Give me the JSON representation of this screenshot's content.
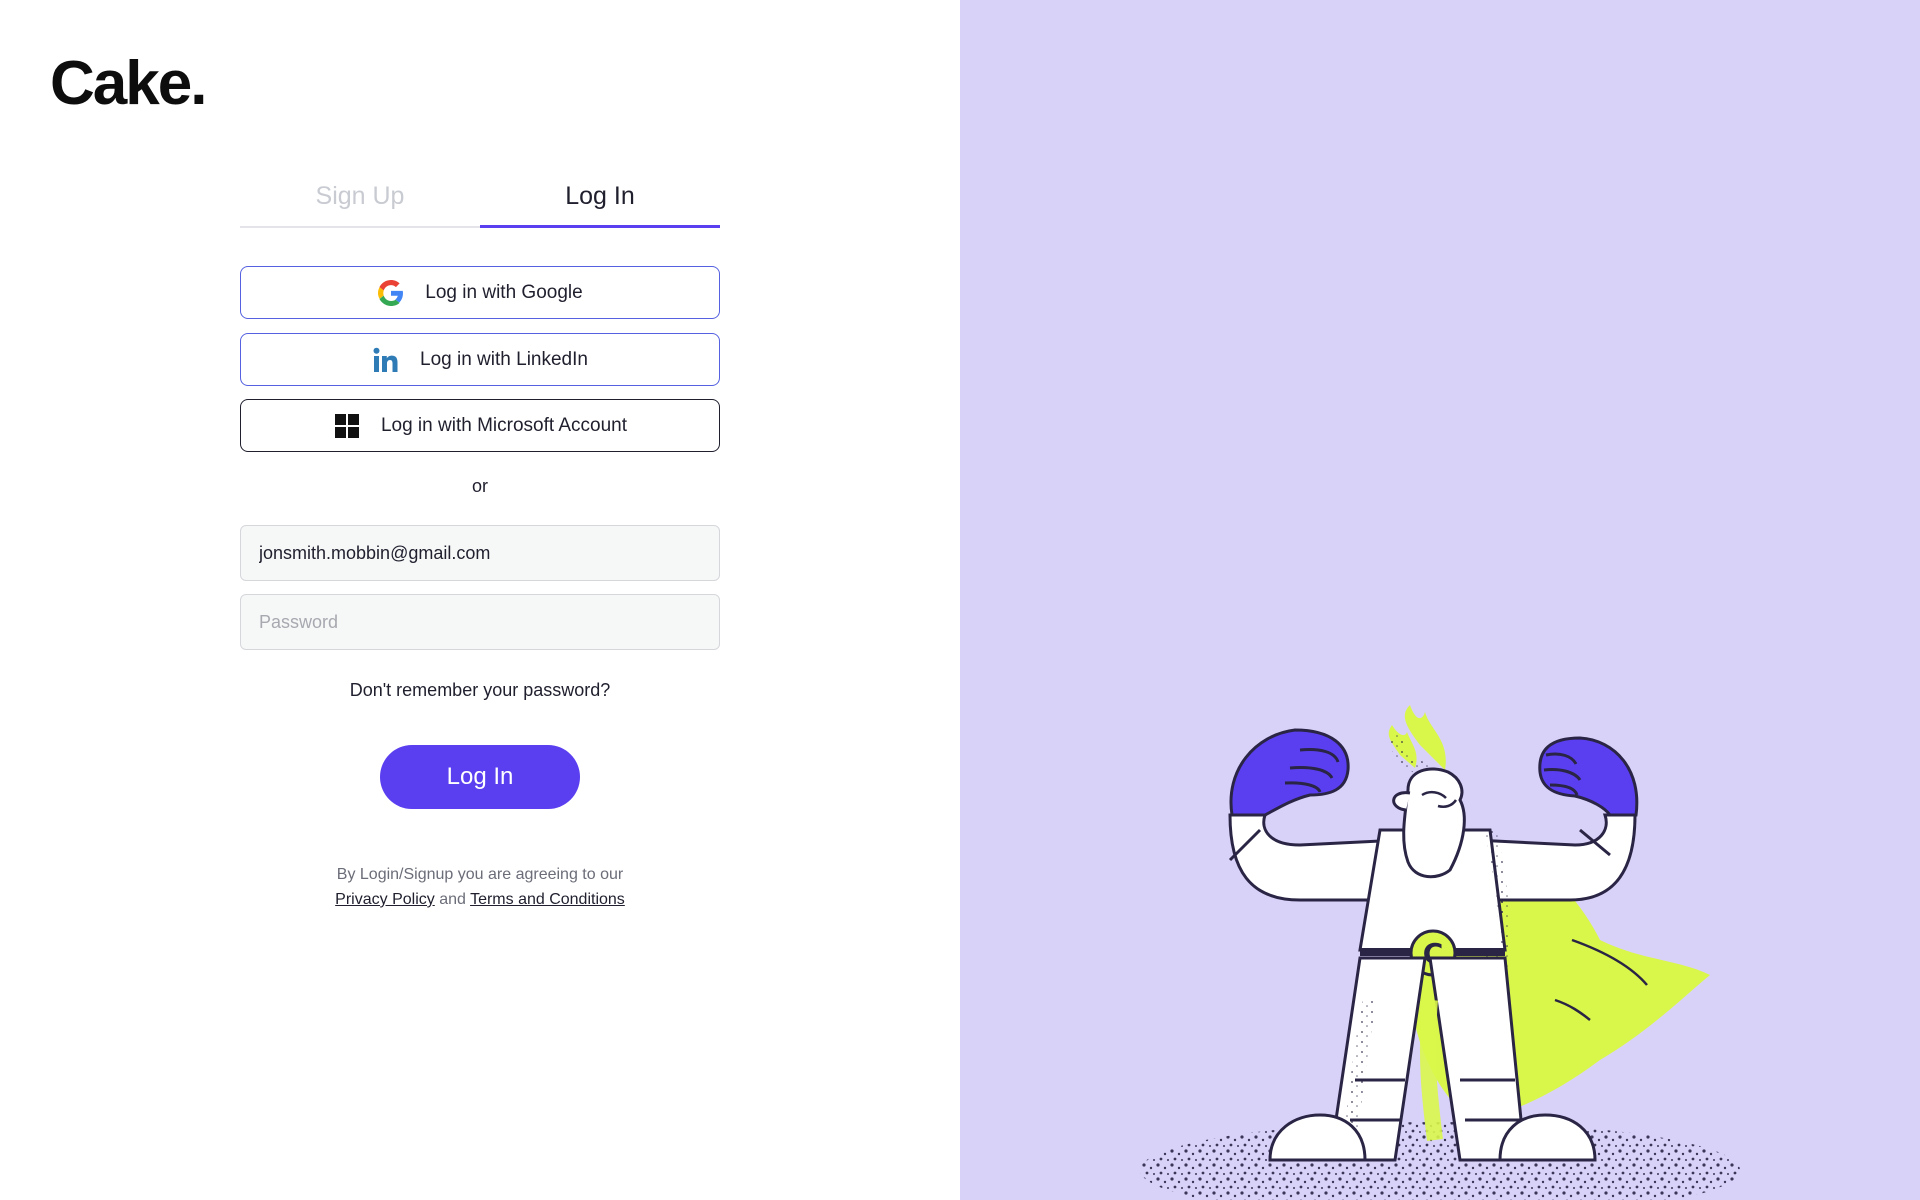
{
  "brand": {
    "logo_text": "Cake."
  },
  "tabs": [
    {
      "label": "Sign Up",
      "active": false
    },
    {
      "label": "Log In",
      "active": true
    }
  ],
  "sso": {
    "google_label": "Log in with Google",
    "linkedin_label": "Log in with LinkedIn",
    "microsoft_label": "Log in with Microsoft Account"
  },
  "divider_text": "or",
  "form": {
    "email_value": "jonsmith.mobbin@gmail.com",
    "password_placeholder": "Password",
    "forgot_label": "Don't remember your password?",
    "submit_label": "Log In"
  },
  "legal": {
    "prefix": "By Login/Signup you are agreeing to our",
    "privacy_label": "Privacy Policy",
    "conjunction": "and",
    "terms_label": "Terms and Conditions"
  },
  "hero_illustration": {
    "badge_letter": "C"
  },
  "colors": {
    "accent": "#5a3ff0",
    "panel_background": "#d8d2f8",
    "lime": "#d9f74a",
    "outline": "#2a2545"
  },
  "icons": [
    "google-icon",
    "linkedin-icon",
    "microsoft-icon"
  ]
}
